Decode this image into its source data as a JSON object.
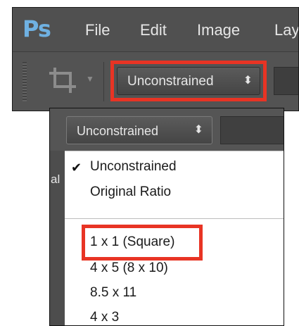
{
  "app": {
    "logo": "Ps"
  },
  "menubar": {
    "items": [
      "File",
      "Edit",
      "Image",
      "Lay"
    ]
  },
  "options_bar": {
    "crop_tool_icon": "crop-icon",
    "ratio_select": {
      "value": "Unconstrained",
      "spinner_glyph": "⬍"
    }
  },
  "dropdown": {
    "selected_value": "Unconstrained",
    "side_label": "al",
    "checkmark": "✔",
    "options": [
      "Unconstrained",
      "Original Ratio",
      "1 x 1 (Square)",
      "4 x 5 (8 x 10)",
      "8.5 x 11",
      "4 x 3"
    ]
  },
  "colors": {
    "highlight": "#e83424",
    "ps_logo": "#6fb1e2",
    "panel_dark": "#535353"
  }
}
